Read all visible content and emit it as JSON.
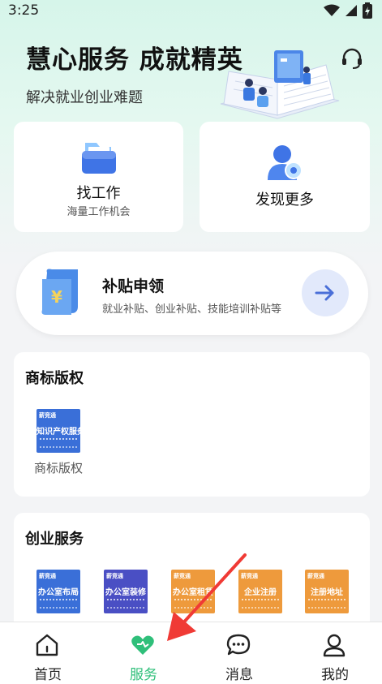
{
  "status_bar": {
    "time": "3:25"
  },
  "hero": {
    "title": "慧心服务 成就精英",
    "subtitle": "解决就业创业难题"
  },
  "cards": [
    {
      "label": "找工作",
      "hint": "海量工作机会"
    },
    {
      "label": "发现更多",
      "hint": ""
    }
  ],
  "subsidy": {
    "title": "补贴申领",
    "desc": "就业补贴、创业补贴、技能培训补贴等",
    "currency_symbol": "¥"
  },
  "brand_section": {
    "title": "商标版权",
    "items": [
      {
        "brand": "薪竞通",
        "thumb_text": "知识产权服务",
        "label": "商标版权",
        "color": "#3a6fd8"
      }
    ]
  },
  "startup_section": {
    "title": "创业服务",
    "items": [
      {
        "brand": "薪竞通",
        "thumb_text": "办公室布局",
        "color": "#3a6fd8"
      },
      {
        "brand": "薪竞通",
        "thumb_text": "办公室装修",
        "color": "#4a4fc4"
      },
      {
        "brand": "薪竞通",
        "thumb_text": "办公室租赁",
        "color": "#ee9a3c"
      },
      {
        "brand": "薪竞通",
        "thumb_text": "企业注册",
        "color": "#ee9a3c"
      },
      {
        "brand": "薪竞通",
        "thumb_text": "注册地址",
        "color": "#ee9a3c"
      }
    ]
  },
  "tabbar": {
    "items": [
      {
        "label": "首页",
        "icon": "home-icon",
        "active": false
      },
      {
        "label": "服务",
        "icon": "heart-icon",
        "active": true
      },
      {
        "label": "消息",
        "icon": "chat-icon",
        "active": false
      },
      {
        "label": "我的",
        "icon": "user-icon",
        "active": false
      }
    ]
  },
  "colors": {
    "accent_green": "#2fbf7a",
    "annotation_red": "#f03a35",
    "arrow_blue": "#4a6fd8"
  }
}
